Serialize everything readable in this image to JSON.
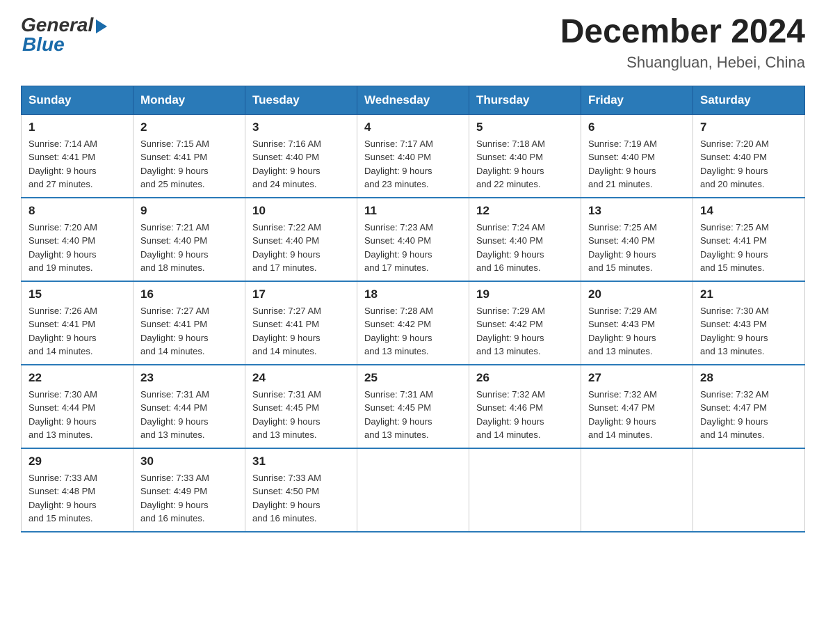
{
  "logo": {
    "general": "General",
    "blue": "Blue"
  },
  "title": "December 2024",
  "location": "Shuangluan, Hebei, China",
  "days_of_week": [
    "Sunday",
    "Monday",
    "Tuesday",
    "Wednesday",
    "Thursday",
    "Friday",
    "Saturday"
  ],
  "weeks": [
    [
      {
        "day": "1",
        "sunrise": "7:14 AM",
        "sunset": "4:41 PM",
        "daylight": "9 hours and 27 minutes."
      },
      {
        "day": "2",
        "sunrise": "7:15 AM",
        "sunset": "4:41 PM",
        "daylight": "9 hours and 25 minutes."
      },
      {
        "day": "3",
        "sunrise": "7:16 AM",
        "sunset": "4:40 PM",
        "daylight": "9 hours and 24 minutes."
      },
      {
        "day": "4",
        "sunrise": "7:17 AM",
        "sunset": "4:40 PM",
        "daylight": "9 hours and 23 minutes."
      },
      {
        "day": "5",
        "sunrise": "7:18 AM",
        "sunset": "4:40 PM",
        "daylight": "9 hours and 22 minutes."
      },
      {
        "day": "6",
        "sunrise": "7:19 AM",
        "sunset": "4:40 PM",
        "daylight": "9 hours and 21 minutes."
      },
      {
        "day": "7",
        "sunrise": "7:20 AM",
        "sunset": "4:40 PM",
        "daylight": "9 hours and 20 minutes."
      }
    ],
    [
      {
        "day": "8",
        "sunrise": "7:20 AM",
        "sunset": "4:40 PM",
        "daylight": "9 hours and 19 minutes."
      },
      {
        "day": "9",
        "sunrise": "7:21 AM",
        "sunset": "4:40 PM",
        "daylight": "9 hours and 18 minutes."
      },
      {
        "day": "10",
        "sunrise": "7:22 AM",
        "sunset": "4:40 PM",
        "daylight": "9 hours and 17 minutes."
      },
      {
        "day": "11",
        "sunrise": "7:23 AM",
        "sunset": "4:40 PM",
        "daylight": "9 hours and 17 minutes."
      },
      {
        "day": "12",
        "sunrise": "7:24 AM",
        "sunset": "4:40 PM",
        "daylight": "9 hours and 16 minutes."
      },
      {
        "day": "13",
        "sunrise": "7:25 AM",
        "sunset": "4:40 PM",
        "daylight": "9 hours and 15 minutes."
      },
      {
        "day": "14",
        "sunrise": "7:25 AM",
        "sunset": "4:41 PM",
        "daylight": "9 hours and 15 minutes."
      }
    ],
    [
      {
        "day": "15",
        "sunrise": "7:26 AM",
        "sunset": "4:41 PM",
        "daylight": "9 hours and 14 minutes."
      },
      {
        "day": "16",
        "sunrise": "7:27 AM",
        "sunset": "4:41 PM",
        "daylight": "9 hours and 14 minutes."
      },
      {
        "day": "17",
        "sunrise": "7:27 AM",
        "sunset": "4:41 PM",
        "daylight": "9 hours and 14 minutes."
      },
      {
        "day": "18",
        "sunrise": "7:28 AM",
        "sunset": "4:42 PM",
        "daylight": "9 hours and 13 minutes."
      },
      {
        "day": "19",
        "sunrise": "7:29 AM",
        "sunset": "4:42 PM",
        "daylight": "9 hours and 13 minutes."
      },
      {
        "day": "20",
        "sunrise": "7:29 AM",
        "sunset": "4:43 PM",
        "daylight": "9 hours and 13 minutes."
      },
      {
        "day": "21",
        "sunrise": "7:30 AM",
        "sunset": "4:43 PM",
        "daylight": "9 hours and 13 minutes."
      }
    ],
    [
      {
        "day": "22",
        "sunrise": "7:30 AM",
        "sunset": "4:44 PM",
        "daylight": "9 hours and 13 minutes."
      },
      {
        "day": "23",
        "sunrise": "7:31 AM",
        "sunset": "4:44 PM",
        "daylight": "9 hours and 13 minutes."
      },
      {
        "day": "24",
        "sunrise": "7:31 AM",
        "sunset": "4:45 PM",
        "daylight": "9 hours and 13 minutes."
      },
      {
        "day": "25",
        "sunrise": "7:31 AM",
        "sunset": "4:45 PM",
        "daylight": "9 hours and 13 minutes."
      },
      {
        "day": "26",
        "sunrise": "7:32 AM",
        "sunset": "4:46 PM",
        "daylight": "9 hours and 14 minutes."
      },
      {
        "day": "27",
        "sunrise": "7:32 AM",
        "sunset": "4:47 PM",
        "daylight": "9 hours and 14 minutes."
      },
      {
        "day": "28",
        "sunrise": "7:32 AM",
        "sunset": "4:47 PM",
        "daylight": "9 hours and 14 minutes."
      }
    ],
    [
      {
        "day": "29",
        "sunrise": "7:33 AM",
        "sunset": "4:48 PM",
        "daylight": "9 hours and 15 minutes."
      },
      {
        "day": "30",
        "sunrise": "7:33 AM",
        "sunset": "4:49 PM",
        "daylight": "9 hours and 16 minutes."
      },
      {
        "day": "31",
        "sunrise": "7:33 AM",
        "sunset": "4:50 PM",
        "daylight": "9 hours and 16 minutes."
      },
      null,
      null,
      null,
      null
    ]
  ],
  "labels": {
    "sunrise": "Sunrise:",
    "sunset": "Sunset:",
    "daylight": "Daylight:"
  }
}
